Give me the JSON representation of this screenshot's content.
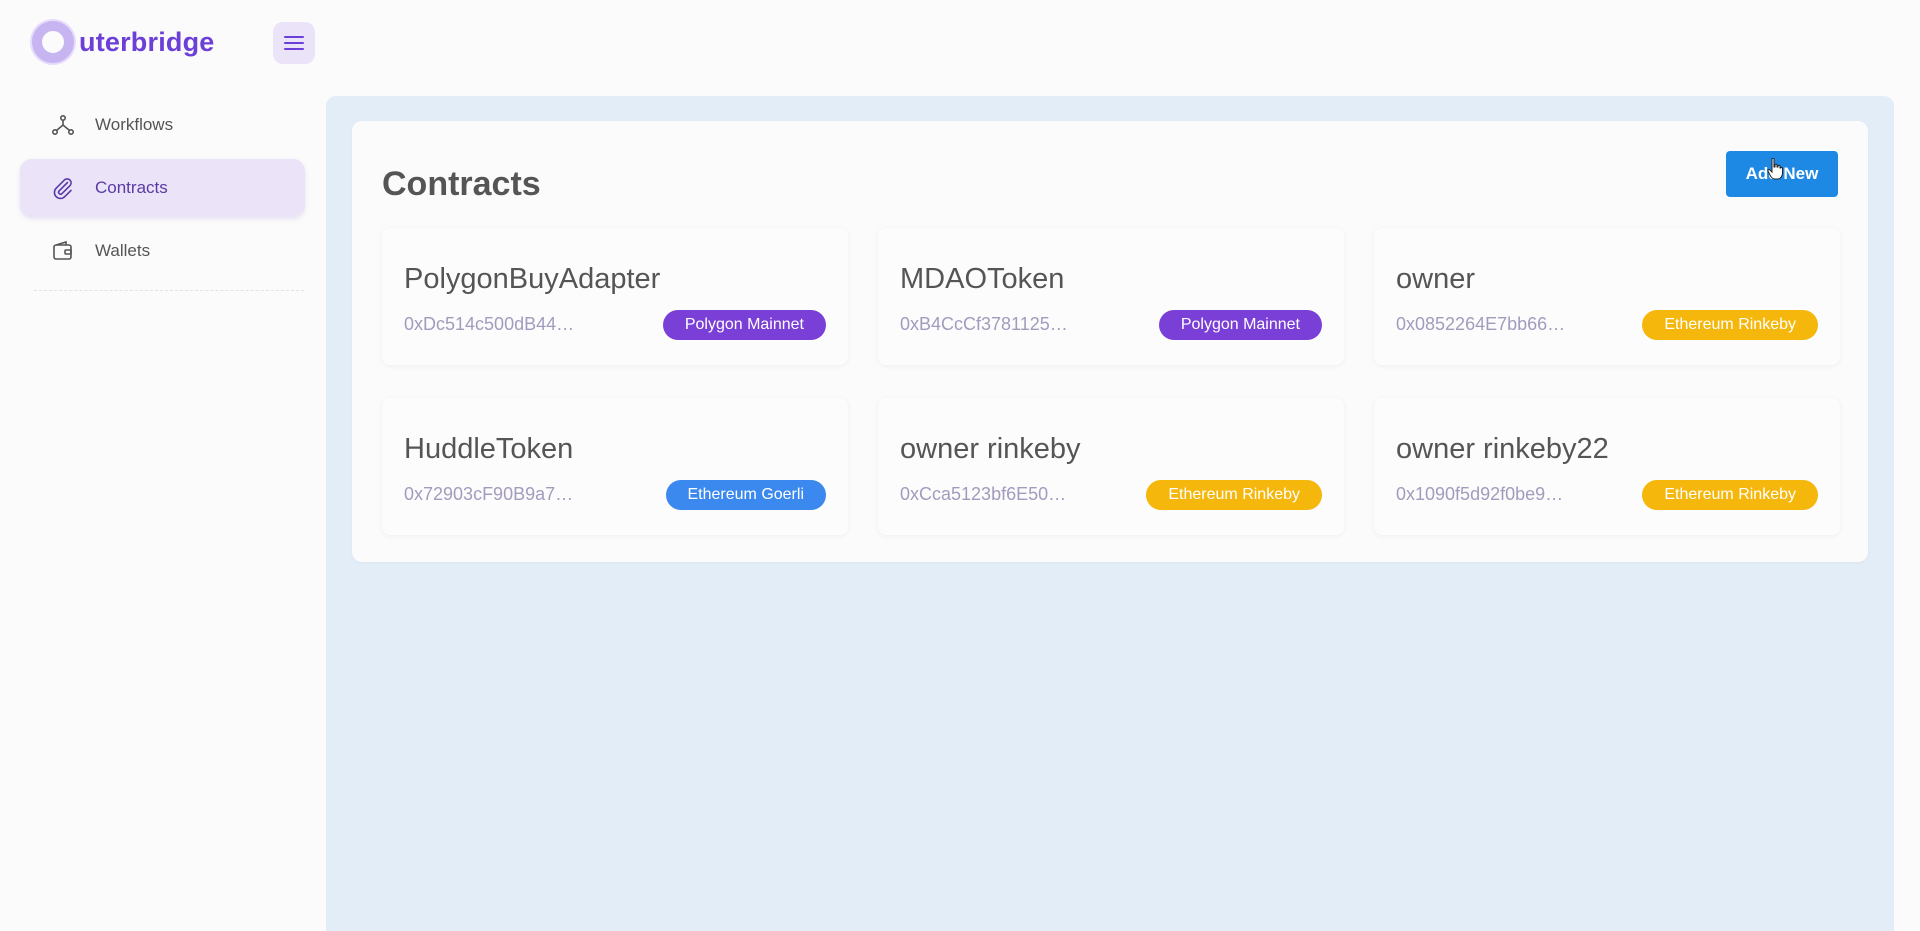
{
  "brand": {
    "name": "uterbridge",
    "logo_color": "#6b3fd8"
  },
  "header": {
    "menu_icon": "hamburger-icon"
  },
  "sidebar": {
    "items": [
      {
        "label": "Workflows",
        "icon": "workflow-icon",
        "active": false
      },
      {
        "label": "Contracts",
        "icon": "paperclip-icon",
        "active": true
      },
      {
        "label": "Wallets",
        "icon": "wallet-icon",
        "active": false
      }
    ]
  },
  "main": {
    "title": "Contracts",
    "add_button_label": "Add New",
    "accent_color": "#1e88e5",
    "contracts": [
      {
        "name": "PolygonBuyAdapter",
        "address": "0xDc514c500dB44…",
        "network": "Polygon Mainnet",
        "network_color": "#7a3fd6"
      },
      {
        "name": "MDAOToken",
        "address": "0xB4CcCf3781125…",
        "network": "Polygon Mainnet",
        "network_color": "#7a3fd6"
      },
      {
        "name": "owner",
        "address": "0x0852264E7bb66…",
        "network": "Ethereum Rinkeby",
        "network_color": "#f5b70c"
      },
      {
        "name": "HuddleToken",
        "address": "0x72903cF90B9a7…",
        "network": "Ethereum Goerli",
        "network_color": "#3b88ee"
      },
      {
        "name": "owner rinkeby",
        "address": "0xCca5123bf6E50…",
        "network": "Ethereum Rinkeby",
        "network_color": "#f5b70c"
      },
      {
        "name": "owner rinkeby22",
        "address": "0x1090f5d92f0be9…",
        "network": "Ethereum Rinkeby",
        "network_color": "#f5b70c"
      }
    ]
  }
}
